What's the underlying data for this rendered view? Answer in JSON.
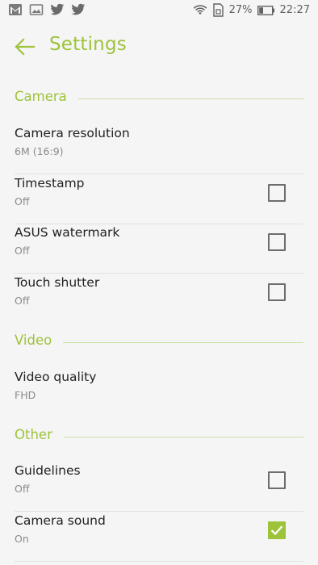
{
  "status_bar": {
    "battery_percent": "27%",
    "time": "22:27",
    "left_icons": [
      "gmail-icon",
      "gallery-icon",
      "twitter-icon",
      "twitter-icon"
    ],
    "right_icons": [
      "wifi-icon",
      "sim-icon",
      "battery-icon"
    ]
  },
  "app_bar": {
    "back_icon": "arrow-left-icon",
    "title": "Settings"
  },
  "sections": {
    "camera": {
      "label": "Camera",
      "items": [
        {
          "title": "Camera resolution",
          "summary": "6M (16:9)"
        },
        {
          "title": "Timestamp",
          "summary": "Off",
          "checked": false
        },
        {
          "title": "ASUS watermark",
          "summary": "Off",
          "checked": false
        },
        {
          "title": "Touch shutter",
          "summary": "Off",
          "checked": false
        }
      ]
    },
    "video": {
      "label": "Video",
      "items": [
        {
          "title": "Video quality",
          "summary": "FHD"
        }
      ]
    },
    "other": {
      "label": "Other",
      "items": [
        {
          "title": "Guidelines",
          "summary": "Off",
          "checked": false
        },
        {
          "title": "Camera sound",
          "summary": "On",
          "checked": true
        }
      ]
    }
  },
  "colors": {
    "accent": "#9dc33b",
    "background": "#f5f5f5",
    "text_primary": "#212121",
    "text_secondary": "#8a8a8a"
  }
}
